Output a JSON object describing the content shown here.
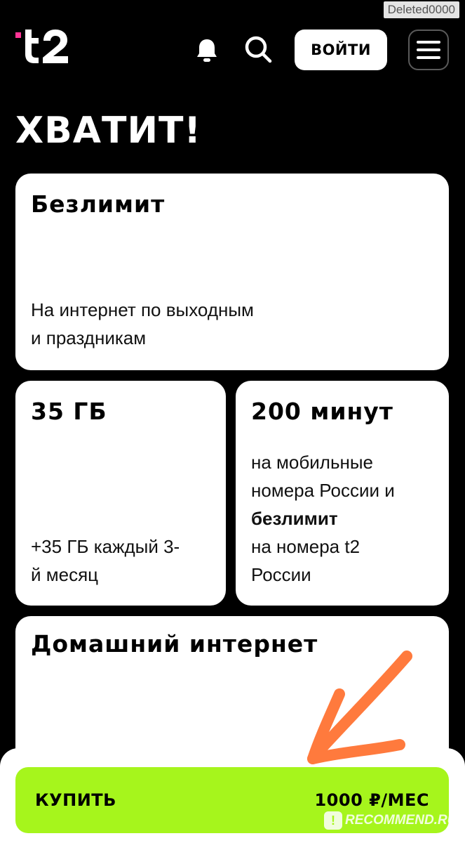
{
  "watermark_top": "Deleted0000",
  "header": {
    "logo_label": "t2",
    "login_label": "ВОЙТИ",
    "icons": [
      "bell-icon",
      "search-icon",
      "menu-icon"
    ]
  },
  "headline": "ХВАТИТ!",
  "cards": {
    "unlimited": {
      "title": "Безлимит",
      "desc_line1": "На интернет по выходным",
      "desc_line2": "и праздникам"
    },
    "data": {
      "title": "35 ГБ",
      "desc_line1": "+35 ГБ каждый 3-",
      "desc_line2": "й месяц"
    },
    "minutes": {
      "title": "200 минут",
      "desc_line1": "на мобильные",
      "desc_line2": "номера России и",
      "desc_bold": "безлимит",
      "desc_line3": "на номера t2",
      "desc_line4": "России"
    },
    "home_internet": {
      "title": "Домашний интернет"
    }
  },
  "buy": {
    "label": "КУПИТЬ",
    "price": "1000 ₽/МЕС"
  },
  "watermark_bottom": "RECOMMEND.RU",
  "colors": {
    "background": "#000000",
    "card": "#ffffff",
    "accent_green": "#a6f51c",
    "logo_pink": "#ff3495",
    "annotation_orange": "#ff7a3d"
  }
}
